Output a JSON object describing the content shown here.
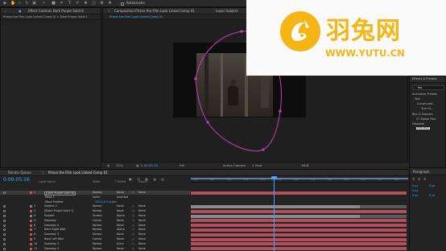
{
  "toolbar": {
    "project_name": "Rotobrushe"
  },
  "left_panel": {
    "tab": "Effect Controls Dark Purple Solid 8",
    "breadcrumb": "Prison the Film Look Linked Camp 0) > Dark Purple Solid 1"
  },
  "comp_panel": {
    "tab": "Composition Prison the Film Look Linked Comp 01",
    "subtab": "Prison the Film Look Linked Comp 01",
    "layer_tab": "Layer Subject"
  },
  "viewer_footer": {
    "zoom": "25%",
    "timecode": "0:00:05:16",
    "resolution": "Full",
    "camera": "Active Camera",
    "views": "1 View",
    "exposure": "+0.0"
  },
  "right_panel": {
    "tab": "Effects & Presets",
    "search": "foo",
    "items": [
      "Animation Presets",
      "Text",
      "Curves and...",
      "Turn Fo...",
      "Blur & Sharpen",
      "CC Radial Fast",
      "Obsolete",
      "Fast Blur"
    ]
  },
  "timeline": {
    "tab_render": "Render Queue",
    "tab_comp": "Prison the Film Look Linked Comp 01",
    "timecode": "0:00:05:16",
    "col_layer": "Layer Name",
    "col_mode": "Mode",
    "col_trkmat": "T TrkMat",
    "col_parent": "Parent",
    "ruler": [
      "00s",
      "01s",
      "02s",
      "03s",
      "04s",
      "05s",
      "06s",
      "07s",
      "08s",
      "09s",
      "10s",
      "11s",
      "12s"
    ],
    "rows": [
      {
        "num": "1",
        "name": "[Dark Purple Solid 8]",
        "mode": "Norma",
        "trk": "None",
        "parent": "None",
        "bar": "#b0505a"
      },
      {
        "num": "",
        "name": "Mask 1",
        "mode": "Subtr",
        "trk": "Inverted",
        "parent": "",
        "bar": ""
      },
      {
        "num": "",
        "name": "Mask Feather",
        "mode": "100.0,0.0 pixels",
        "trk": "",
        "parent": "",
        "bar": ""
      },
      {
        "num": "2",
        "name": "Subject 2",
        "mode": "Norma",
        "trk": "None",
        "parent": "None",
        "bar": "#8a8a8a"
      },
      {
        "num": "3",
        "name": "[Black Purple Solid 7]",
        "mode": "Norma",
        "trk": "None",
        "parent": "None",
        "bar": "#b0505a"
      },
      {
        "num": "4",
        "name": "Subject",
        "mode": "Screen",
        "trk": "Alpha",
        "parent": "None",
        "bar": "#8a8a8a"
      },
      {
        "num": "5",
        "name": "Doorway",
        "mode": "Overla",
        "trk": "None",
        "parent": "None",
        "bar": "#b0505a"
      },
      {
        "num": "6",
        "name": "Doorway 4",
        "mode": "Norma",
        "trk": "None",
        "parent": "None",
        "bar": "#b0505a"
      },
      {
        "num": "7",
        "name": "Back Right Wall",
        "mode": "Norma",
        "trk": "Alpha",
        "parent": "None",
        "bar": "#b0505a"
      },
      {
        "num": "8",
        "name": "Doorway 3",
        "mode": "Norma",
        "trk": "None",
        "parent": "None",
        "bar": "#b0505a"
      },
      {
        "num": "9",
        "name": "Back Left Wall",
        "mode": "Overla",
        "trk": "None",
        "parent": "None",
        "bar": "#b0505a"
      },
      {
        "num": "10",
        "name": "Doorway 2",
        "mode": "Norma",
        "trk": "A.Inv",
        "parent": "None",
        "bar": "#b0505a"
      },
      {
        "num": "11",
        "name": "Doorway 3",
        "mode": "Norma",
        "trk": "None",
        "parent": "None",
        "bar": "#b0505a"
      }
    ]
  },
  "paragraph": {
    "tab": "Paragraph",
    "values": [
      "0 px",
      "0 px",
      "0 px",
      "0 px",
      "0 px"
    ]
  },
  "logo": {
    "name": "羽兔网",
    "url": "WWW.YUTU.CN",
    "color": "#f5b615"
  },
  "colors": {
    "mask_path": "#c53fb8",
    "playhead": "#4aa3ff",
    "label_red": "#c0555a"
  }
}
